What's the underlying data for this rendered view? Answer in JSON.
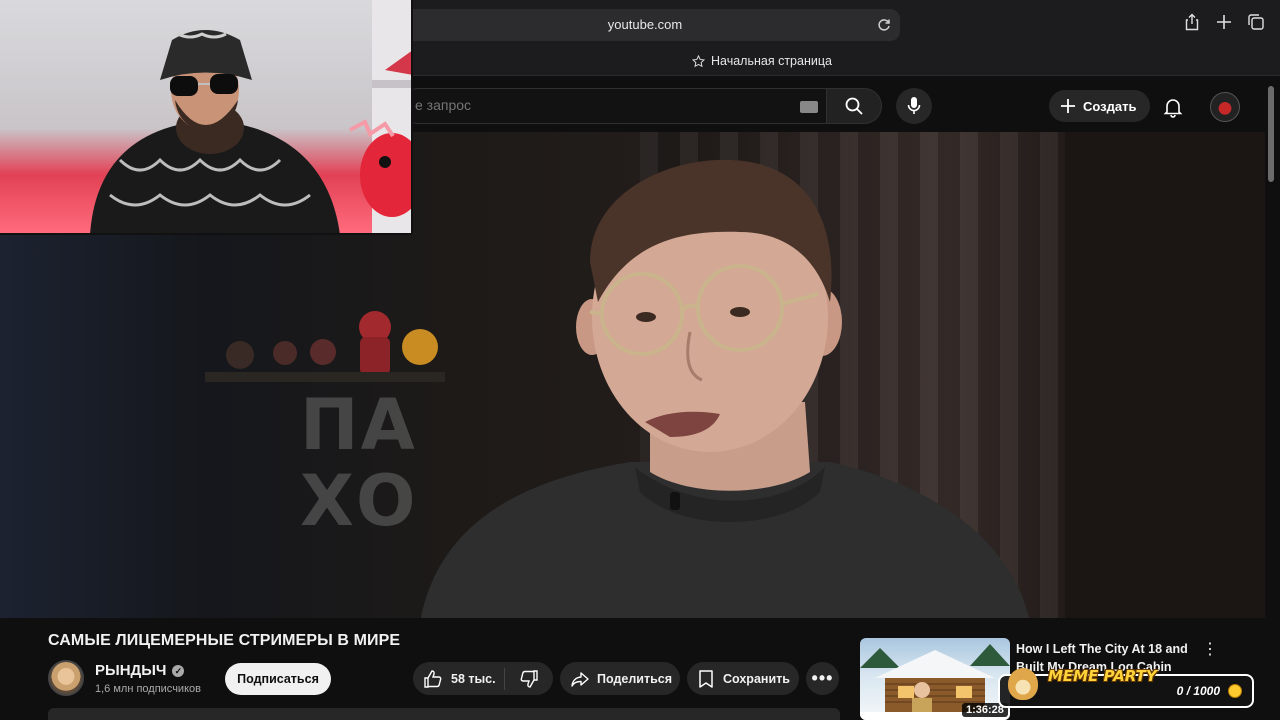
{
  "browser": {
    "address": "youtube.com",
    "favorites_item": "Начальная страница"
  },
  "masthead": {
    "search_placeholder": "е запрос",
    "create_label": "Создать"
  },
  "video": {
    "title": "САМЫЕ ЛИЦЕМЕРНЫЕ СТРИМЕРЫ В МИРЕ",
    "background_sign": [
      "ПА",
      "ХО"
    ],
    "channel": {
      "name": "РЫНДЫЧ",
      "subscribers": "1,6 млн подписчиков",
      "subscribe_label": "Подписаться"
    },
    "actions": {
      "likes": "58 тыс.",
      "share_label": "Поделиться",
      "save_label": "Сохранить",
      "more_label": "•••"
    }
  },
  "recommendation": {
    "title": "How I Left The City At 18 and Built My Dream Log Cabin",
    "duration": "1:36:28",
    "menu_label": "⋮"
  },
  "overlay": {
    "label": "MEME PARTY",
    "progress": "0 / 1000"
  }
}
